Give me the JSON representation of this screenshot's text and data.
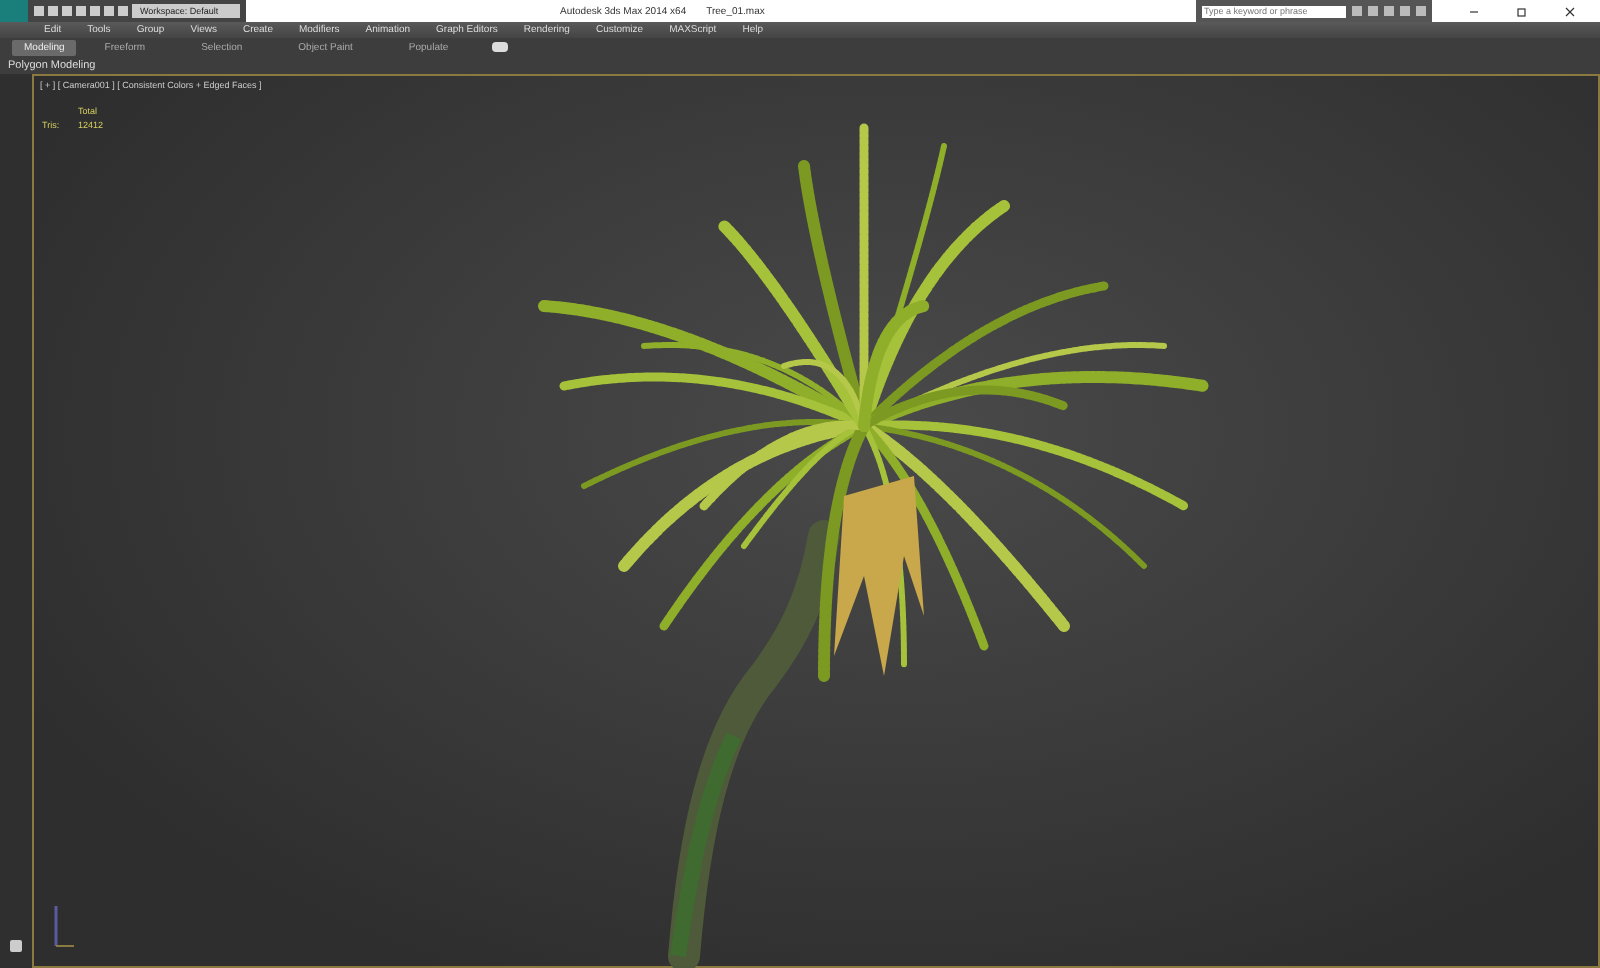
{
  "title_bar": {
    "workspace": "Workspace: Default",
    "app_title": "Autodesk 3ds Max  2014 x64",
    "file_name": "Tree_01.max",
    "search": {
      "placeholder": "Type a keyword or phrase"
    }
  },
  "menu": [
    "Edit",
    "Tools",
    "Group",
    "Views",
    "Create",
    "Modifiers",
    "Animation",
    "Graph Editors",
    "Rendering",
    "Customize",
    "MAXScript",
    "Help"
  ],
  "ribbon_tabs": [
    {
      "label": "Modeling",
      "selected": true
    },
    {
      "label": "Freeform",
      "selected": false
    },
    {
      "label": "Selection",
      "selected": false
    },
    {
      "label": "Object Paint",
      "selected": false
    },
    {
      "label": "Populate",
      "selected": false
    }
  ],
  "ribbon_panel": "Polygon Modeling",
  "viewport": {
    "label": "[ + ] [ Camera001 ] [ Consistent Colors + Edged Faces ]",
    "stats_header": "Total",
    "stats": [
      {
        "name": "Tris:",
        "value": "12412"
      }
    ]
  }
}
